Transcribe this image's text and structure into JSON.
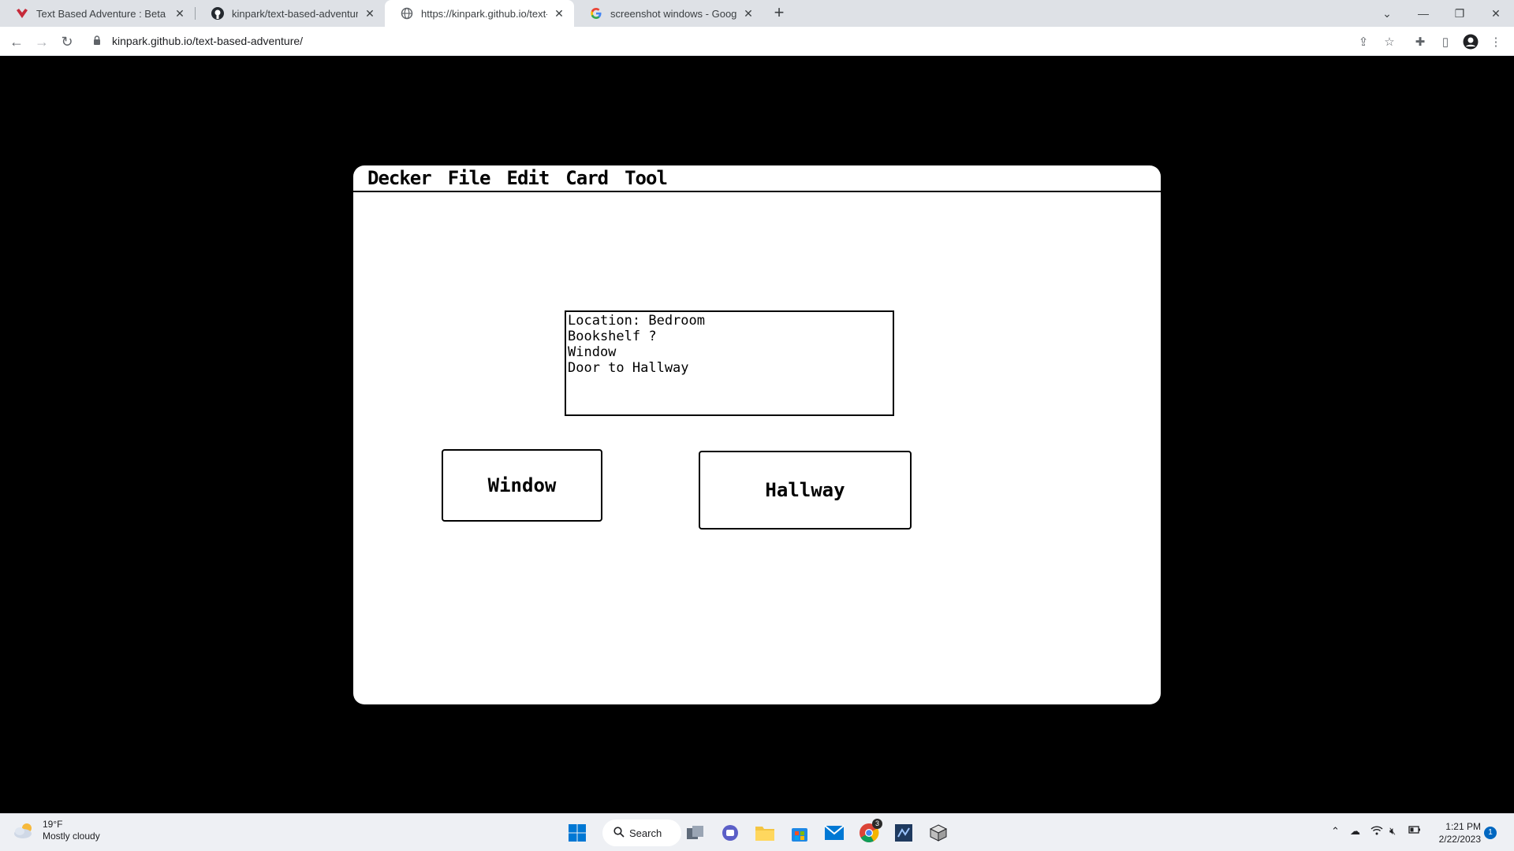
{
  "browser": {
    "tabs": [
      {
        "title": "Text Based Adventure : Beta Versi",
        "favicon": "itchio-icon"
      },
      {
        "title": "kinpark/text-based-adventure",
        "favicon": "github-icon"
      },
      {
        "title": "https://kinpark.github.io/text-bas",
        "favicon": "globe-icon"
      },
      {
        "title": "screenshot windows - Google Se",
        "favicon": "google-icon"
      }
    ],
    "url": "kinpark.github.io/text-based-adventure/"
  },
  "decker": {
    "menu": [
      "Decker",
      "File",
      "Edit",
      "Card",
      "Tool"
    ],
    "field_lines": [
      "Location: Bedroom",
      "Bookshelf ?",
      "Window",
      "Door to Hallway"
    ],
    "buttons": {
      "window": "Window",
      "hallway": "Hallway"
    }
  },
  "taskbar": {
    "weather_temp": "19°F",
    "weather_desc": "Mostly cloudy",
    "search_label": "Search",
    "time": "1:21 PM",
    "date": "2/22/2023",
    "notification_count": "1",
    "chrome_badge": "3"
  }
}
